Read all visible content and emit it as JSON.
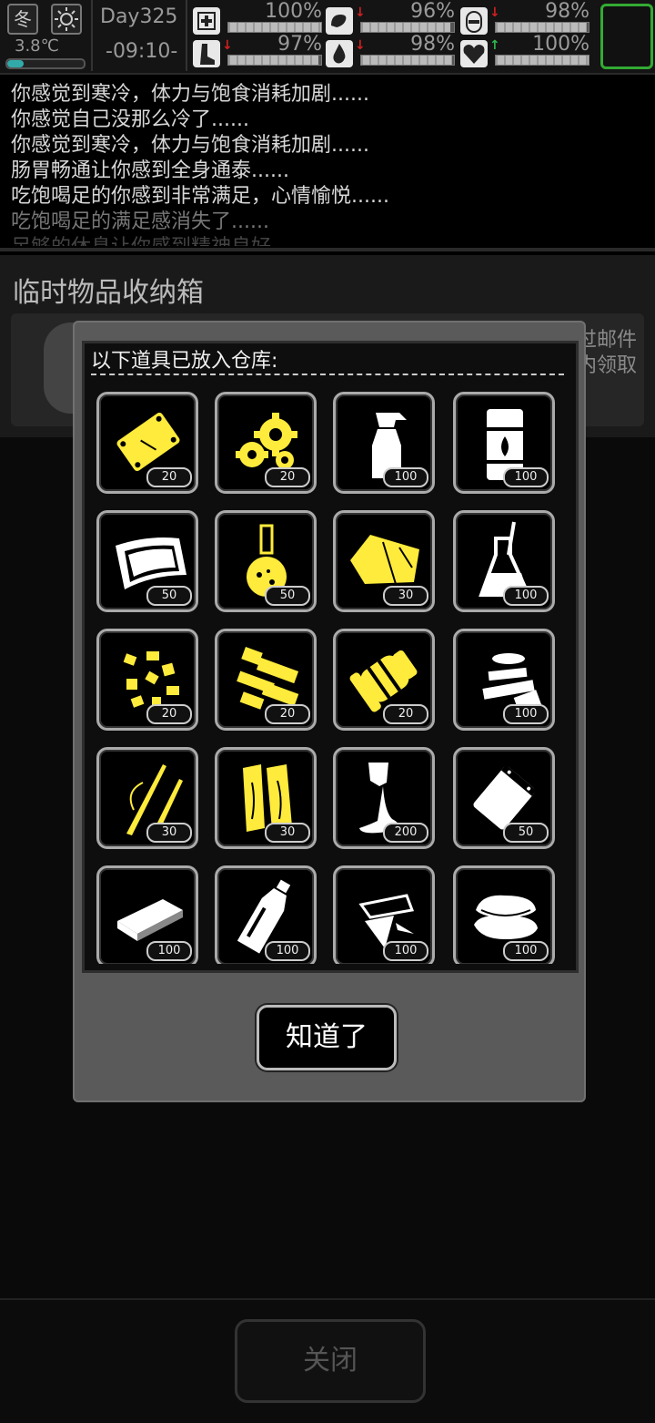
{
  "status": {
    "season_icon": "冬",
    "temperature": "3.8℃",
    "day": "Day325",
    "time": "-09:10-",
    "stats": [
      {
        "name": "health-icon",
        "value": "100%",
        "level": 1.0,
        "trend": ""
      },
      {
        "name": "hunger-icon",
        "value": "96%",
        "level": 0.96,
        "trend": "down"
      },
      {
        "name": "energy-icon",
        "value": "98%",
        "level": 0.98,
        "trend": "down"
      },
      {
        "name": "stamina-icon",
        "value": "97%",
        "level": 0.97,
        "trend": "down"
      },
      {
        "name": "thirst-icon",
        "value": "98%",
        "level": 0.98,
        "trend": "down"
      },
      {
        "name": "mood-icon",
        "value": "100%",
        "level": 1.0,
        "trend": "up"
      }
    ]
  },
  "log": [
    "你感觉到寒冷，体力与饱食消耗加剧......",
    "你感觉自己没那么冷了......",
    "你感觉到寒冷，体力与饱食消耗加剧......",
    "肠胃畅通让你感到全身通泰......",
    "吃饱喝足的你感到非常满足，心情愉悦......",
    "吃饱喝足的满足感消失了......",
    "足够的休息让你感到精神良好......"
  ],
  "storage": {
    "title": "临时物品收纳箱",
    "mail_line1": "过邮件",
    "mail_line2": "内领取"
  },
  "modal": {
    "title": "以下道具已放入仓库:",
    "confirm_label": "知道了",
    "items": [
      {
        "icon": "metal-plate-icon",
        "qty": "20",
        "color": "#ffeb3b"
      },
      {
        "icon": "gears-icon",
        "qty": "20",
        "color": "#ffeb3b"
      },
      {
        "icon": "spray-bottle-icon",
        "qty": "100",
        "color": "#ffffff"
      },
      {
        "icon": "fuel-barrel-icon",
        "qty": "100",
        "color": "#ffffff"
      },
      {
        "icon": "cloth-sheet-icon",
        "qty": "50",
        "color": "#ffffff"
      },
      {
        "icon": "flask-icon",
        "qty": "50",
        "color": "#ffeb3b"
      },
      {
        "icon": "fabric-icon",
        "qty": "30",
        "color": "#ffeb3b"
      },
      {
        "icon": "beaker-icon",
        "qty": "100",
        "color": "#ffffff"
      },
      {
        "icon": "scrap-pieces-icon",
        "qty": "20",
        "color": "#ffeb3b"
      },
      {
        "icon": "machine-parts-icon",
        "qty": "20",
        "color": "#ffeb3b"
      },
      {
        "icon": "cylinder-part-icon",
        "qty": "20",
        "color": "#ffeb3b"
      },
      {
        "icon": "tape-roll-icon",
        "qty": "100",
        "color": "#ffffff"
      },
      {
        "icon": "sticks-icon",
        "qty": "30",
        "color": "#ffeb3b"
      },
      {
        "icon": "wood-planks-icon",
        "qty": "30",
        "color": "#ffeb3b"
      },
      {
        "icon": "glue-tube-icon",
        "qty": "200",
        "color": "#ffffff"
      },
      {
        "icon": "pouch-icon",
        "qty": "50",
        "color": "#ffffff"
      },
      {
        "icon": "board-icon",
        "qty": "100",
        "color": "#ffffff"
      },
      {
        "icon": "bottle-icon",
        "qty": "100",
        "color": "#ffffff"
      },
      {
        "icon": "glass-shards-icon",
        "qty": "100",
        "color": "#ffffff"
      },
      {
        "icon": "towels-icon",
        "qty": "100",
        "color": "#ffffff"
      }
    ]
  },
  "bottom": {
    "close_label": "关闭"
  }
}
